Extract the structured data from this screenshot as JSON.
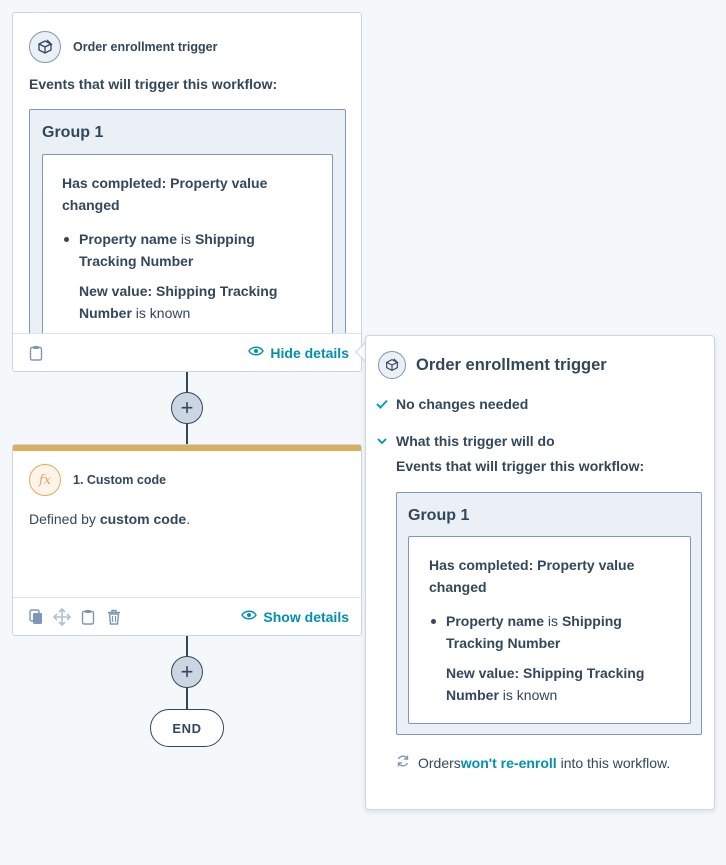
{
  "trigger_card": {
    "title": "Order enrollment trigger",
    "icon": "order-box-icon",
    "events_label": "Events that will trigger this workflow:",
    "group_title": "Group 1",
    "filter": {
      "heading": "Has completed: Property value changed",
      "bullet_bold_1": "Property name",
      "bullet_plain": " is ",
      "bullet_bold_2": "Shipping Tracking Number",
      "new_value_bold_1": "New value: Shipping Tracking Number",
      "new_value_plain": " is known"
    },
    "footer_icon": "clipboard-icon",
    "details_link": "Hide details",
    "details_icon": "eye-icon"
  },
  "code_card": {
    "title": "1. Custom code",
    "icon_text": "fx",
    "body_prefix": "Defined by ",
    "body_bold": "custom code",
    "body_suffix": ".",
    "footer_icons": [
      "copy-icon",
      "move-icon",
      "clipboard-icon",
      "trash-icon"
    ],
    "details_link": "Show details",
    "details_icon": "eye-icon"
  },
  "flow": {
    "add_label": "+",
    "end_label": "END"
  },
  "popover": {
    "title": "Order enrollment trigger",
    "icon": "order-box-icon",
    "status_text": "No changes needed",
    "section_label": "What this trigger will do",
    "events_label": "Events that will trigger this workflow:",
    "group_title": "Group 1",
    "filter": {
      "heading": "Has completed: Property value changed",
      "bullet_bold_1": "Property name",
      "bullet_plain": " is ",
      "bullet_bold_2": "Shipping Tracking Number",
      "new_value_bold_1": "New value: Shipping Tracking Number",
      "new_value_plain": " is known"
    },
    "reenroll_prefix": "Orders ",
    "reenroll_link": "won't re-enroll",
    "reenroll_suffix": " into this workflow."
  },
  "colors": {
    "text": "#33475b",
    "link": "#0091ae",
    "accent_bar": "#dbae60",
    "check": "#00a4bd"
  }
}
